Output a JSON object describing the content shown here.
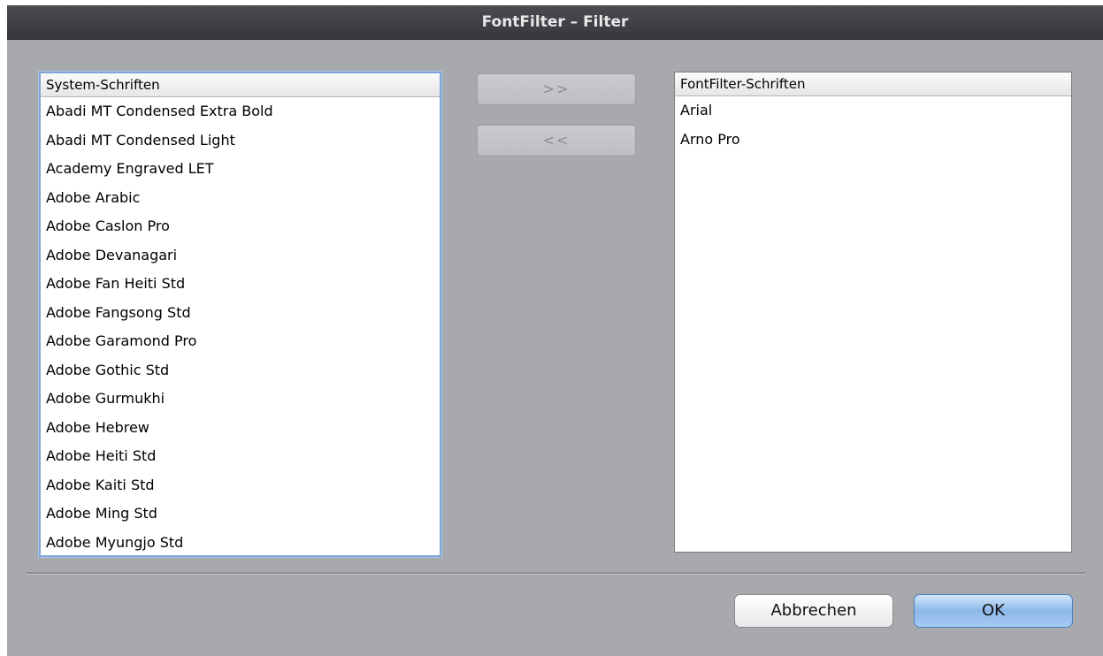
{
  "window": {
    "title": "FontFilter – Filter"
  },
  "left_list": {
    "header": "System-Schriften",
    "items": [
      "Abadi MT Condensed Extra Bold",
      "Abadi MT Condensed Light",
      "Academy Engraved LET",
      "Adobe Arabic",
      "Adobe Caslon Pro",
      "Adobe Devanagari",
      "Adobe Fan Heiti Std",
      "Adobe Fangsong Std",
      "Adobe Garamond Pro",
      "Adobe Gothic Std",
      "Adobe Gurmukhi",
      "Adobe Hebrew",
      "Adobe Heiti Std",
      "Adobe Kaiti Std",
      "Adobe Ming Std",
      "Adobe Myungjo Std"
    ]
  },
  "right_list": {
    "header": "FontFilter-Schriften",
    "items": [
      "Arial",
      "Arno Pro"
    ]
  },
  "move_buttons": {
    "add": ">>",
    "remove": "<<"
  },
  "footer": {
    "cancel": "Abbrechen",
    "ok": "OK"
  }
}
